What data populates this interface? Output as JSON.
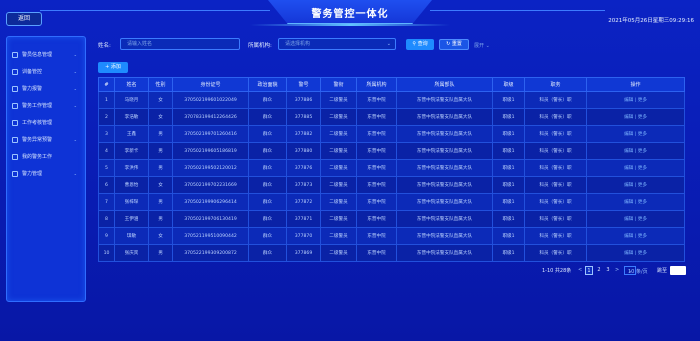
{
  "header": {
    "back_label": "返回",
    "title": "警务管控一体化",
    "datetime": "2021年05月26日星期三09:29:16"
  },
  "sidebar": {
    "items": [
      {
        "label": "警员信息管理",
        "has_chevron": true
      },
      {
        "label": "训备管控",
        "has_chevron": true
      },
      {
        "label": "警力报警",
        "has_chevron": true
      },
      {
        "label": "警务工作管理",
        "has_chevron": true
      },
      {
        "label": "工作考核管理",
        "has_chevron": false
      },
      {
        "label": "警务异常预警",
        "has_chevron": true
      },
      {
        "label": "我的警务工作",
        "has_chevron": false
      },
      {
        "label": "警力管理",
        "has_chevron": true
      }
    ]
  },
  "filters": {
    "name_label": "姓名:",
    "name_placeholder": "请输入姓名",
    "org_label": "所属机构:",
    "org_placeholder": "请选择机构",
    "search_label": "查询",
    "reset_label": "重置",
    "expand_label": "展开"
  },
  "toolbar": {
    "add_label": "+ 添加"
  },
  "table": {
    "columns": [
      "#",
      "姓名",
      "性别",
      "身份证号",
      "政治面貌",
      "警号",
      "警衔",
      "所属机构",
      "所属部队",
      "职级",
      "职务",
      "操作"
    ],
    "rows": [
      [
        "1",
        "马晓月",
        "女",
        "370502199601022049",
        "群众",
        "377886",
        "二级警员",
        "东营中院",
        "东营中院法警支队直属大队",
        "职级1",
        "科员（警长）职",
        "编辑 | 更多"
      ],
      [
        "2",
        "李浩敏",
        "女",
        "370783199412264426",
        "群众",
        "377885",
        "二级警员",
        "东营中院",
        "东营中院法警支队直属大队",
        "职级1",
        "科员（警长）职",
        "编辑 | 更多"
      ],
      [
        "3",
        "王鑫",
        "男",
        "370502199701260416",
        "群众",
        "377882",
        "二级警员",
        "东营中院",
        "东营中院法警支队直属大队",
        "职级1",
        "科员（警长）职",
        "编辑 | 更多"
      ],
      [
        "4",
        "李新卡",
        "男",
        "370502199605186819",
        "群众",
        "377880",
        "二级警员",
        "东营中院",
        "东营中院法警支队直属大队",
        "职级1",
        "科员（警长）职",
        "编辑 | 更多"
      ],
      [
        "5",
        "李洪伟",
        "男",
        "370502199502120012",
        "群众",
        "377876",
        "二级警员",
        "东营中院",
        "东营中院法警支队直属大队",
        "职级1",
        "科员（警长）职",
        "编辑 | 更多"
      ],
      [
        "6",
        "曹恩怡",
        "女",
        "370502199702231669",
        "群众",
        "377873",
        "二级警员",
        "东营中院",
        "东营中院法警支队直属大队",
        "职级1",
        "科员（警长）职",
        "编辑 | 更多"
      ],
      [
        "7",
        "张梓琛",
        "男",
        "370502199906296414",
        "群众",
        "377872",
        "二级警员",
        "东营中院",
        "东营中院法警支队直属大队",
        "职级1",
        "科员（警长）职",
        "编辑 | 更多"
      ],
      [
        "8",
        "王伊涵",
        "男",
        "370502199706130419",
        "群众",
        "377871",
        "二级警员",
        "东营中院",
        "东营中院法警支队直属大队",
        "职级1",
        "科员（警长）职",
        "编辑 | 更多"
      ],
      [
        "9",
        "琪敏",
        "女",
        "370521199510090442",
        "群众",
        "377870",
        "二级警员",
        "东营中院",
        "东营中院法警支队直属大队",
        "职级1",
        "科员（警长）职",
        "编辑 | 更多"
      ],
      [
        "10",
        "张庆宾",
        "男",
        "370522199309200872",
        "群众",
        "377869",
        "二级警员",
        "东营中院",
        "东营中院法警支队直属大队",
        "职级1",
        "科员（警长）职",
        "编辑 | 更多"
      ]
    ]
  },
  "pagination": {
    "summary": "1-10 共28条",
    "prev": "<",
    "pages": [
      "1",
      "2",
      "3"
    ],
    "next": ">",
    "page_size": "10 条/页",
    "goto_label": "跳至"
  }
}
